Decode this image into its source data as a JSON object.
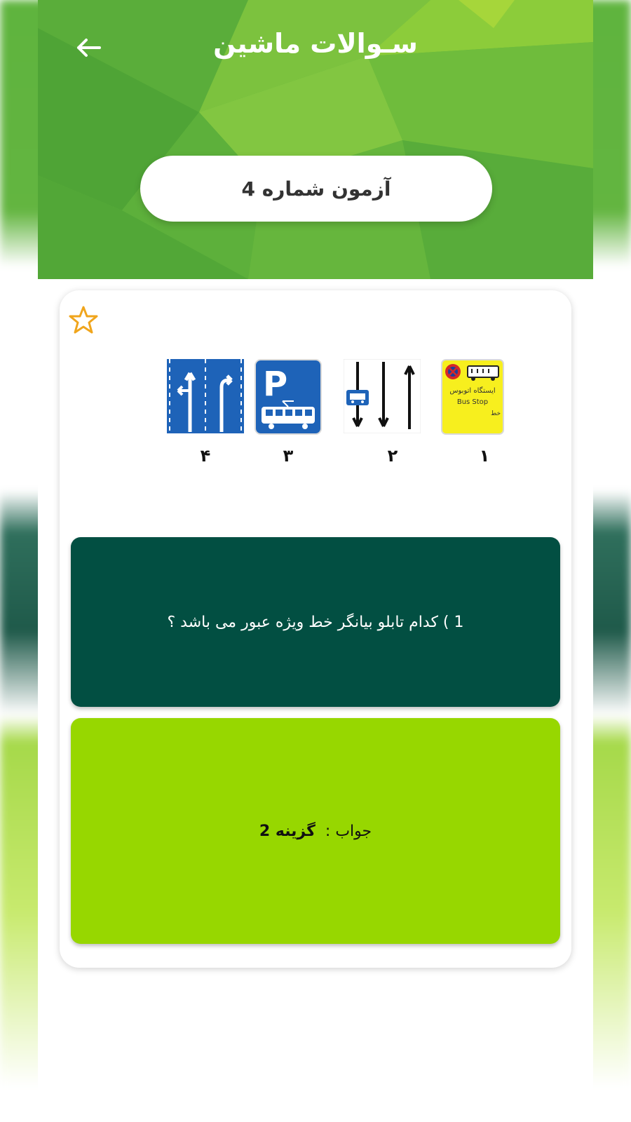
{
  "app": {
    "title": "سـوالات ماشین"
  },
  "exam": {
    "label": "آزمون شماره 4"
  },
  "signs": {
    "bus_stop_text_fa": "ایستگاه اتوبوس",
    "bus_stop_text_en": "Bus Stop",
    "bus_stop_line": "خط",
    "numbers": [
      "۱",
      "۲",
      "۳",
      "۴"
    ]
  },
  "question": {
    "text": "1 ) کدام تابلو بیانگر خط ویژه عبور می باشد ؟"
  },
  "answer": {
    "label": "جواب :",
    "value": "گزینه 2"
  },
  "colors": {
    "header_green": "#62b43f",
    "question_bg": "#024f42",
    "answer_bg": "#97d700",
    "star": "#f0a51c"
  }
}
